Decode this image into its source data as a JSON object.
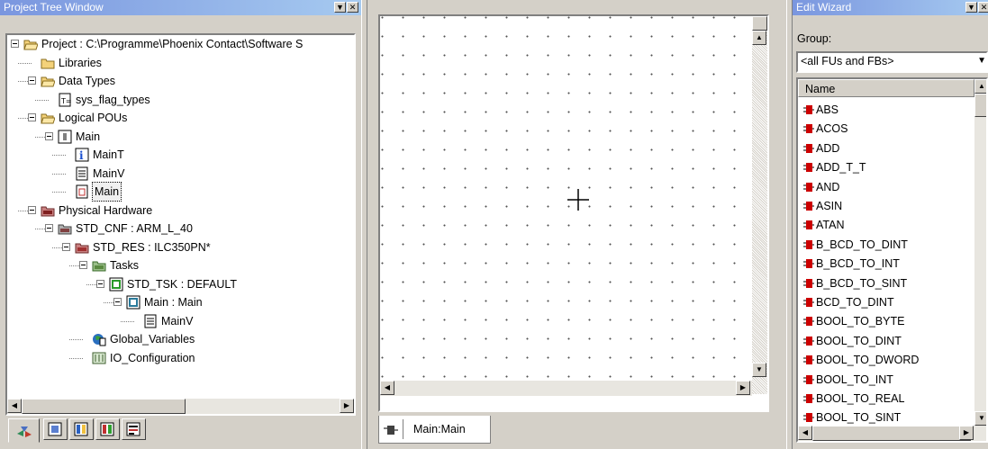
{
  "left_panel": {
    "title": "Project Tree Window",
    "tree": [
      {
        "label": "Project : C:\\Programme\\Phoenix Contact\\Software S",
        "icon": "open-folder-icon"
      },
      {
        "label": "Libraries",
        "icon": "folder-icon"
      },
      {
        "label": "Data Types",
        "icon": "open-folder-icon"
      },
      {
        "label": "sys_flag_types",
        "icon": "datatype-file-icon"
      },
      {
        "label": "Logical POUs",
        "icon": "open-folder-icon"
      },
      {
        "label": "Main",
        "icon": "pou-icon"
      },
      {
        "label": "MainT",
        "icon": "info-icon"
      },
      {
        "label": "MainV",
        "icon": "variables-icon"
      },
      {
        "label": "Main",
        "icon": "code-worksheet-icon"
      },
      {
        "label": "Physical Hardware",
        "icon": "hardware-folder-icon"
      },
      {
        "label": "STD_CNF : ARM_L_40",
        "icon": "configuration-icon"
      },
      {
        "label": "STD_RES : ILC350PN*",
        "icon": "resource-icon"
      },
      {
        "label": "Tasks",
        "icon": "tasks-folder-icon"
      },
      {
        "label": "STD_TSK : DEFAULT",
        "icon": "task-icon"
      },
      {
        "label": "Main : Main",
        "icon": "program-instance-icon"
      },
      {
        "label": "MainV",
        "icon": "variables-icon"
      },
      {
        "label": "Global_Variables",
        "icon": "global-variables-icon"
      },
      {
        "label": "IO_Configuration",
        "icon": "io-configuration-icon"
      }
    ],
    "bottom_tabs": [
      "project-tree-tab-icon",
      "tab-2-icon",
      "tab-3-icon",
      "tab-4-icon",
      "tab-5-icon"
    ]
  },
  "editor": {
    "tab_label": "Main:Main"
  },
  "right_panel": {
    "title": "Edit Wizard",
    "group_label": "Group:",
    "group_value": "<all FUs and FBs>",
    "column_header": "Name",
    "items": [
      "ABS",
      "ACOS",
      "ADD",
      "ADD_T_T",
      "AND",
      "ASIN",
      "ATAN",
      "B_BCD_TO_DINT",
      "B_BCD_TO_INT",
      "B_BCD_TO_SINT",
      "BCD_TO_DINT",
      "BOOL_TO_BYTE",
      "BOOL_TO_DINT",
      "BOOL_TO_DWORD",
      "BOOL_TO_INT",
      "BOOL_TO_REAL",
      "BOOL_TO_SINT"
    ]
  },
  "colors": {
    "titlebar_start": "#7a96df",
    "titlebar_end": "#a6caf0",
    "fb_icon": "#cc0000",
    "window_bg": "#d4d0c8"
  }
}
